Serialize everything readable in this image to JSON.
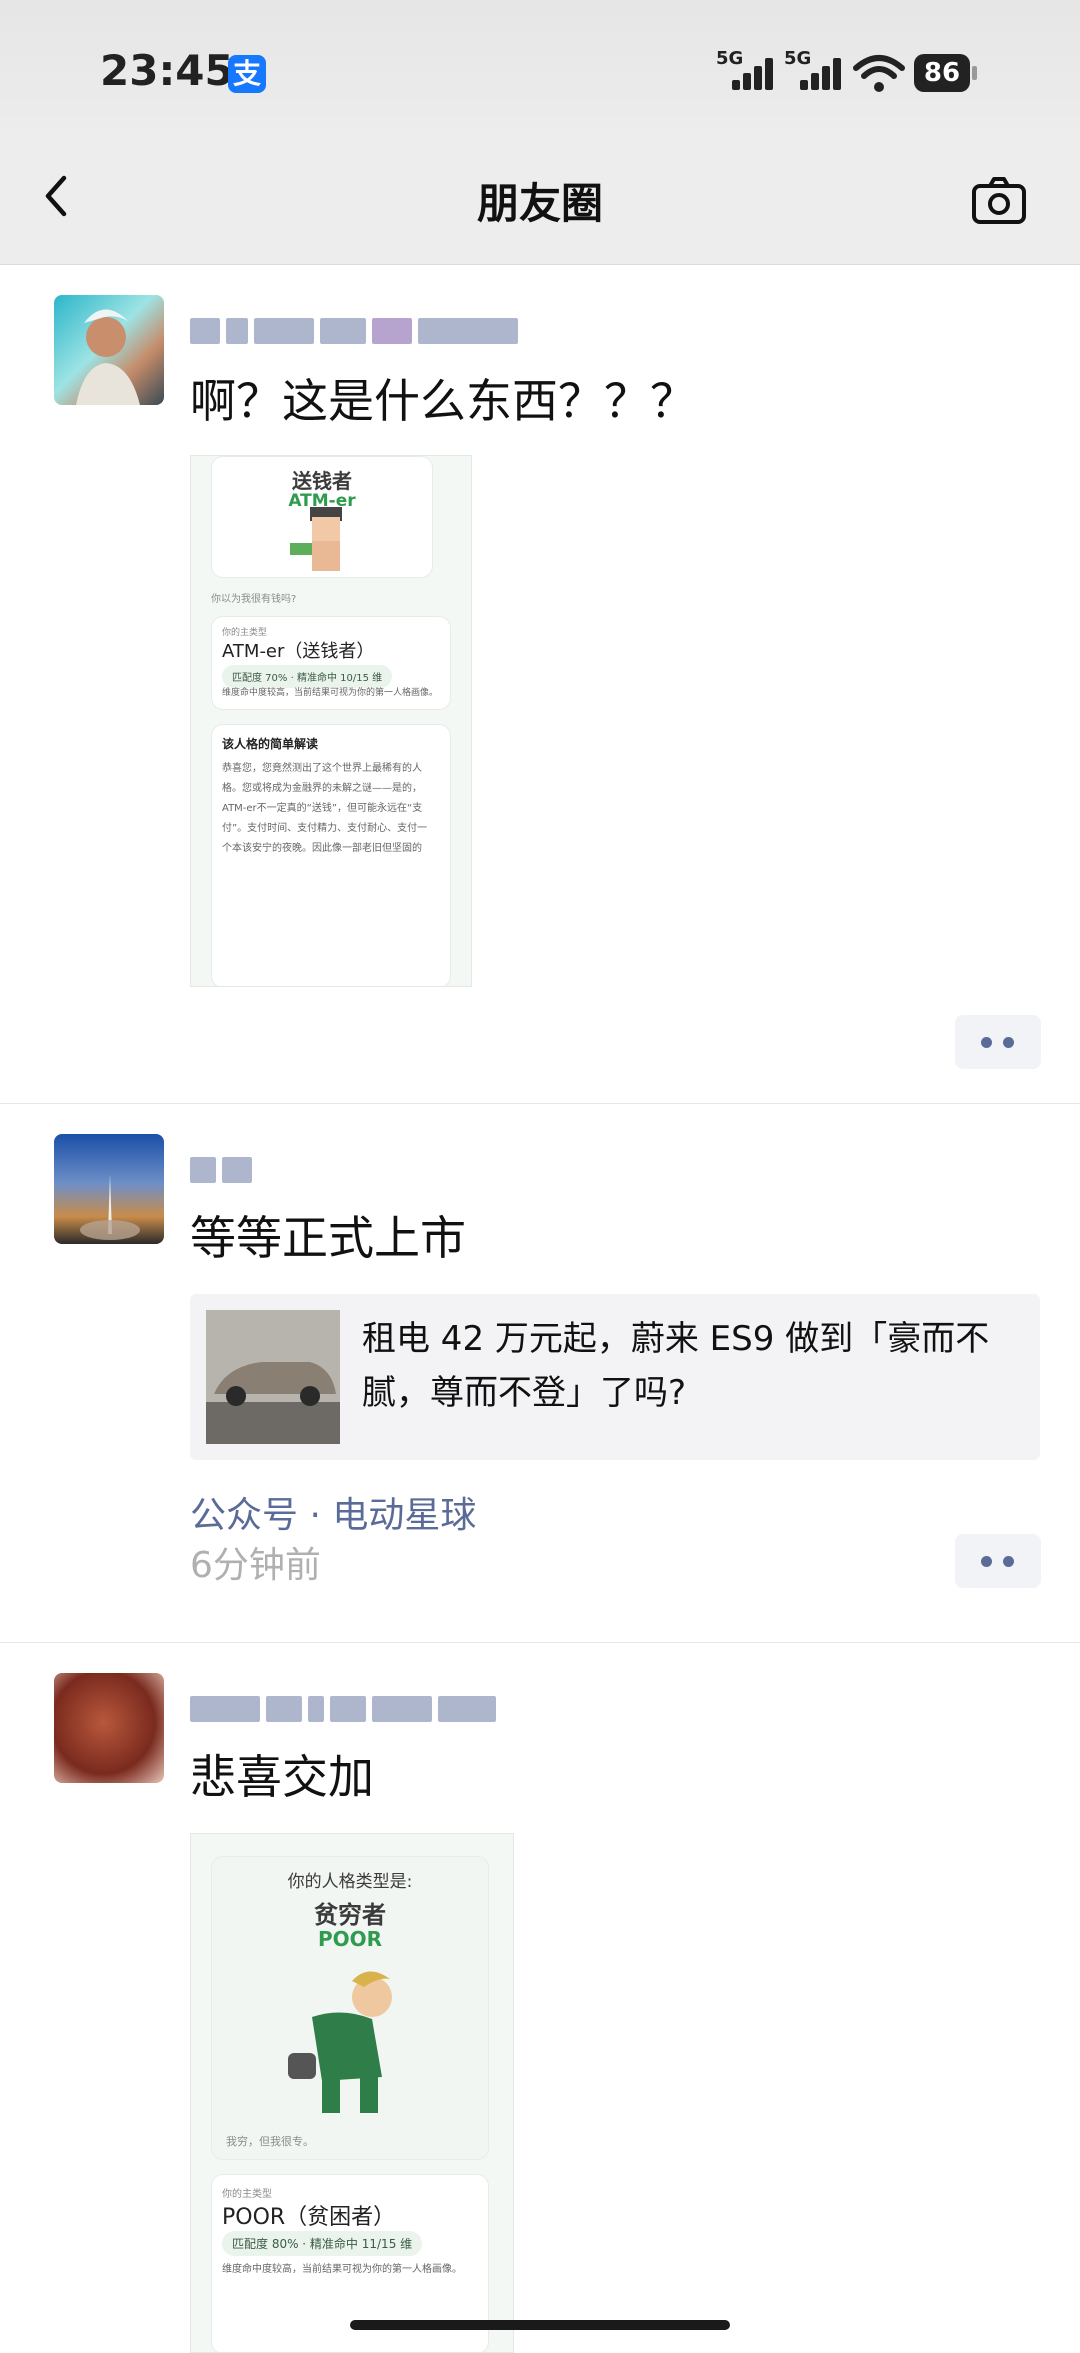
{
  "status": {
    "time": "23:45",
    "alipay_glyph": "支",
    "sim1": "5G",
    "sim2": "5G",
    "battery": "86"
  },
  "nav": {
    "title": "朋友圈",
    "back_icon": "chevron-left-icon",
    "camera_icon": "camera-icon"
  },
  "posts": [
    {
      "text": "啊？这是什么东西？？？",
      "screenshot": {
        "title": "送钱者",
        "subtitle": "ATM-er",
        "caption": "你以为我很有钱吗?",
        "main_type_label": "你的主类型",
        "main_type": "ATM-er（送钱者）",
        "match_pill": "匹配度 70% · 精准命中 10/15 维",
        "note": "维度命中度较高，当前结果可视为你的第一人格画像。",
        "section_title": "该人格的简单解读",
        "paragraph": [
          "恭喜您，您竟然测出了这个世界上最稀有的人",
          "格。您或将成为金融界的未解之谜——是的，",
          "ATM-er不一定真的“送钱”，但可能永远在“支",
          "付”。支付时间、支付精力、支付耐心、支付一",
          "个本该安宁的夜晚。因此像一部老旧但坚固的"
        ]
      }
    },
    {
      "text": "等等正式上市",
      "link_title": "租电 42 万元起，蔚来 ES9 做到「豪而不腻，尊而不登」了吗?",
      "source": "公众号 · 电动星球",
      "time": "6分钟前"
    },
    {
      "text": "悲喜交加",
      "screenshot": {
        "header": "你的人格类型是:",
        "title": "贫穷者",
        "subtitle": "POOR",
        "caption": "我穷，但我很专。",
        "main_type_label": "你的主类型",
        "main_type": "POOR（贫困者）",
        "match_pill": "匹配度 80% · 精准命中 11/15 维",
        "note": "维度命中度较高，当前结果可视为你的第一人格画像。"
      }
    }
  ],
  "colors": {
    "link_blue": "#5b6b97",
    "green_accent": "#2e9b4f",
    "nav_bg": "#ededed"
  }
}
